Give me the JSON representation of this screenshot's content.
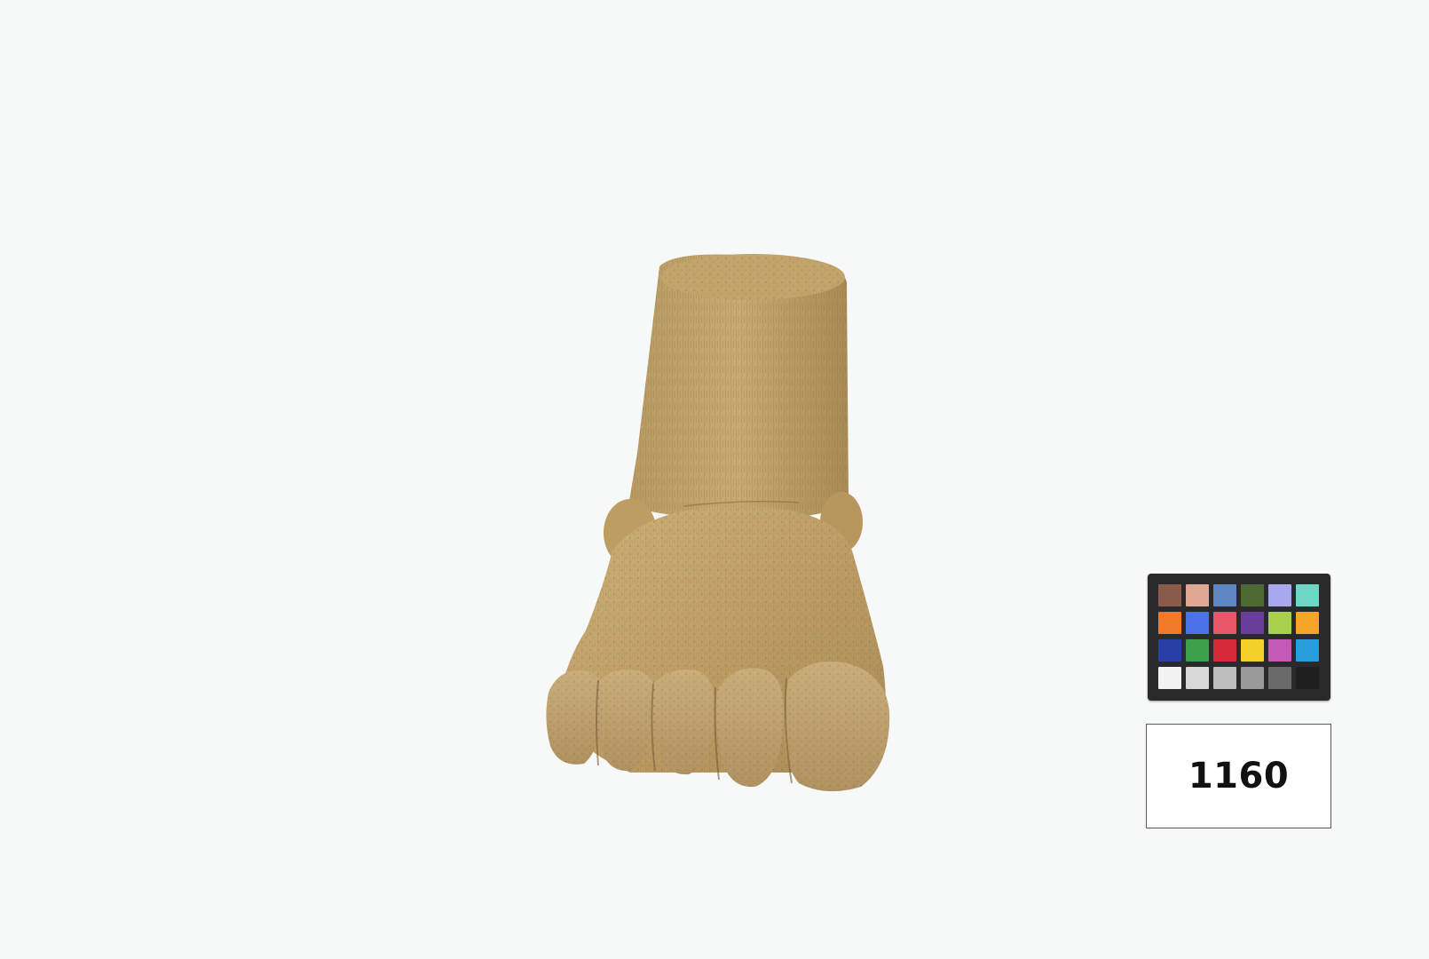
{
  "photo": {
    "background_color": "#f7f8f8",
    "subject_icon": "carved-wooden-foot-icon"
  },
  "color_checker": {
    "icon": "color-checker-chart-icon",
    "patches": [
      "#8a5a4a",
      "#e0a894",
      "#5f87c4",
      "#4e6a32",
      "#a8a8f0",
      "#6ed6c4",
      "#f07a2a",
      "#4c72e8",
      "#e8566a",
      "#6a3f9c",
      "#a8d04a",
      "#f4a62a",
      "#2a3ea8",
      "#3ea04a",
      "#d62a3a",
      "#f4d02a",
      "#c45ab8",
      "#2a9ed8",
      "#f2f2f2",
      "#d8d8d8",
      "#bcbcbc",
      "#9a9a9a",
      "#6a6a6a",
      "#1e1e1e"
    ]
  },
  "specimen_label": {
    "number": "1160"
  }
}
